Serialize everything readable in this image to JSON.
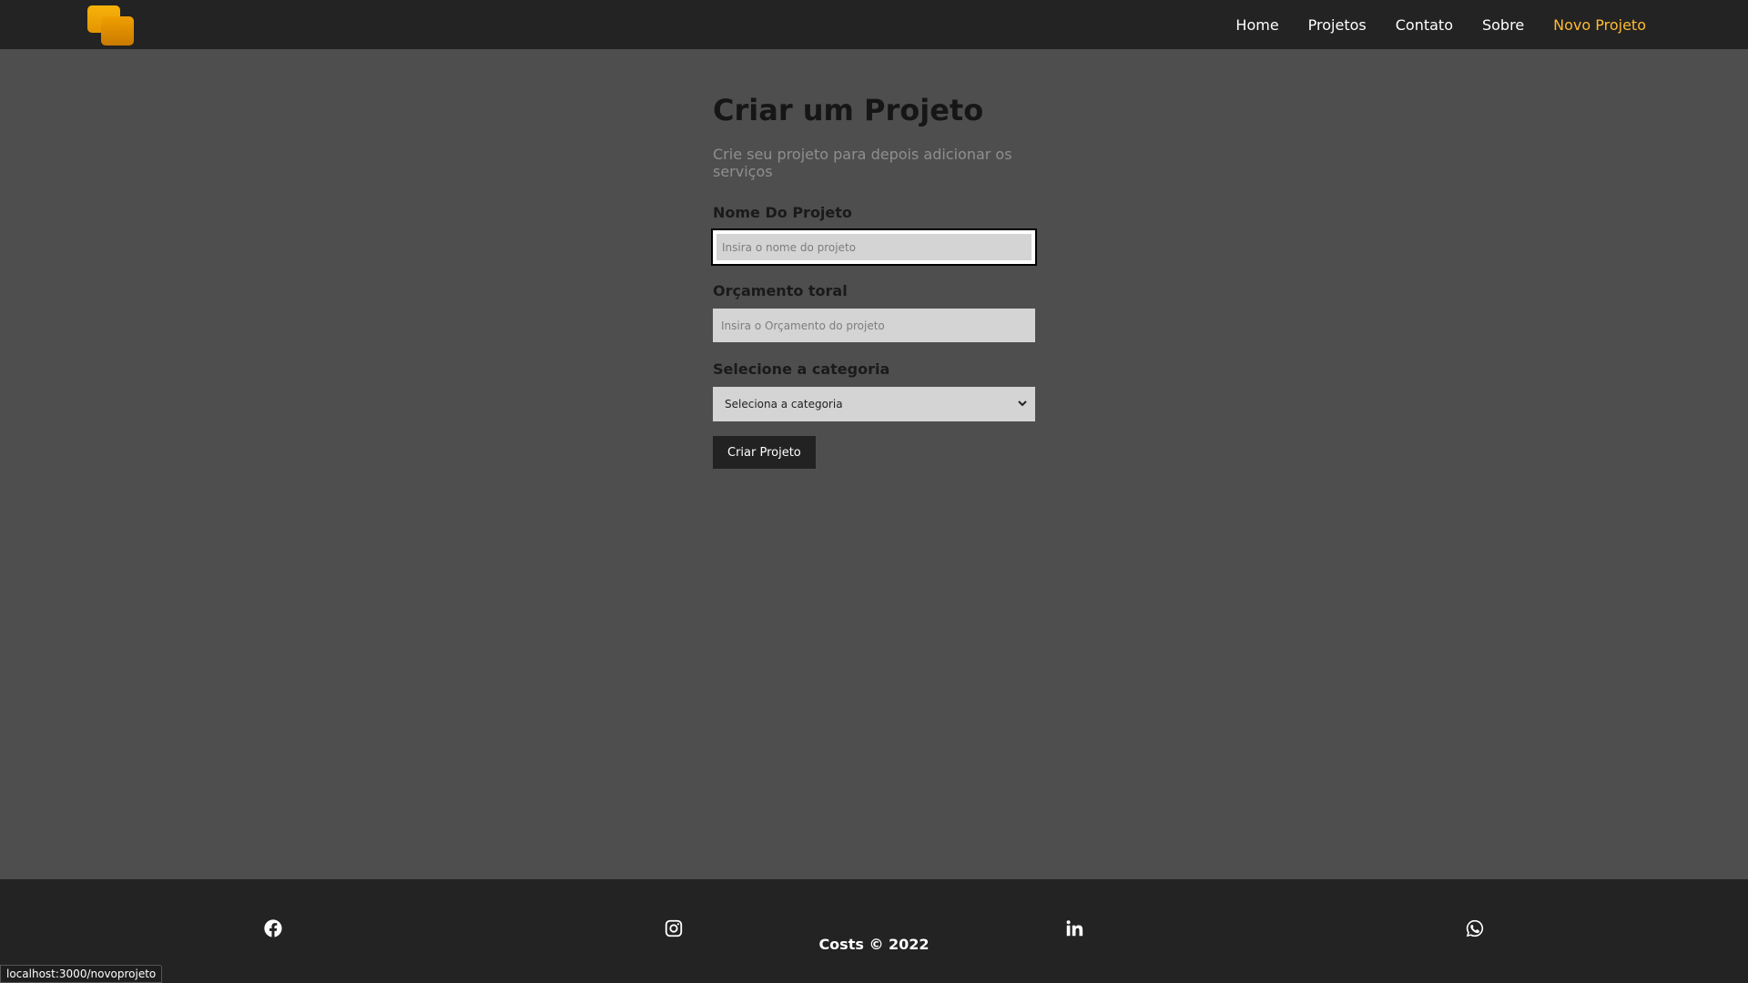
{
  "navbar": {
    "logo_icon": "costs-logo-icon",
    "links": [
      {
        "label": "Home"
      },
      {
        "label": "Projetos"
      },
      {
        "label": "Contato"
      },
      {
        "label": "Sobre"
      },
      {
        "label": "Novo Projeto"
      }
    ],
    "active_color": "#ffbb33"
  },
  "main": {
    "title": "Criar um Projeto",
    "subtitle": "Crie seu projeto para depois adicionar os serviços",
    "form": {
      "name_label": "Nome Do Projeto",
      "name_placeholder": "Insira o nome do projeto",
      "name_value": "",
      "budget_label": "Orçamento toral",
      "budget_placeholder": "Insira o Orçamento do projeto",
      "budget_value": "",
      "category_label": "Selecione a categoria",
      "category_selected": "Seleciona a categoria",
      "submit_label": "Criar Projeto"
    }
  },
  "footer": {
    "social_icons": [
      "facebook-icon",
      "instagram-icon",
      "linkedin-icon",
      "whatsapp-icon"
    ],
    "copyright": "Costs © 2022"
  },
  "status_bar": {
    "url": "localhost:3000/novoprojeto"
  },
  "colors": {
    "navbar_bg": "#232323",
    "page_bg": "#4e4e4e",
    "accent": "#ffbb33"
  }
}
